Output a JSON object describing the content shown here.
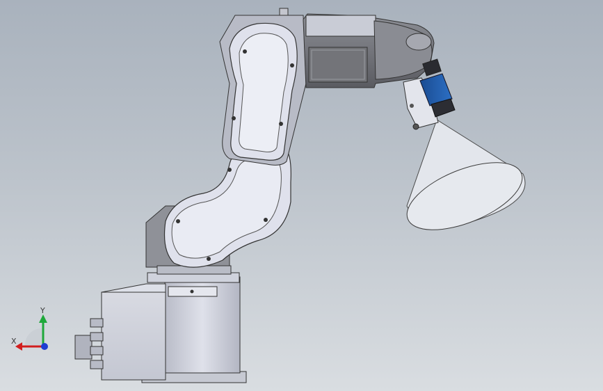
{
  "viewport": {
    "background_top": "#a9b2bd",
    "background_bottom": "#d9dde1"
  },
  "model": {
    "base_color": "#c9ccd6",
    "link_color": "#dadcea",
    "arm_dark": "#5f6066",
    "camera_color": "#1f5aa8",
    "cone_color": "#dde1e8"
  },
  "triad": {
    "x_label": "X",
    "y_label": "Y",
    "x_color": "#d21e1e",
    "y_color": "#1ea83a",
    "z_color": "#1e3ed2"
  }
}
